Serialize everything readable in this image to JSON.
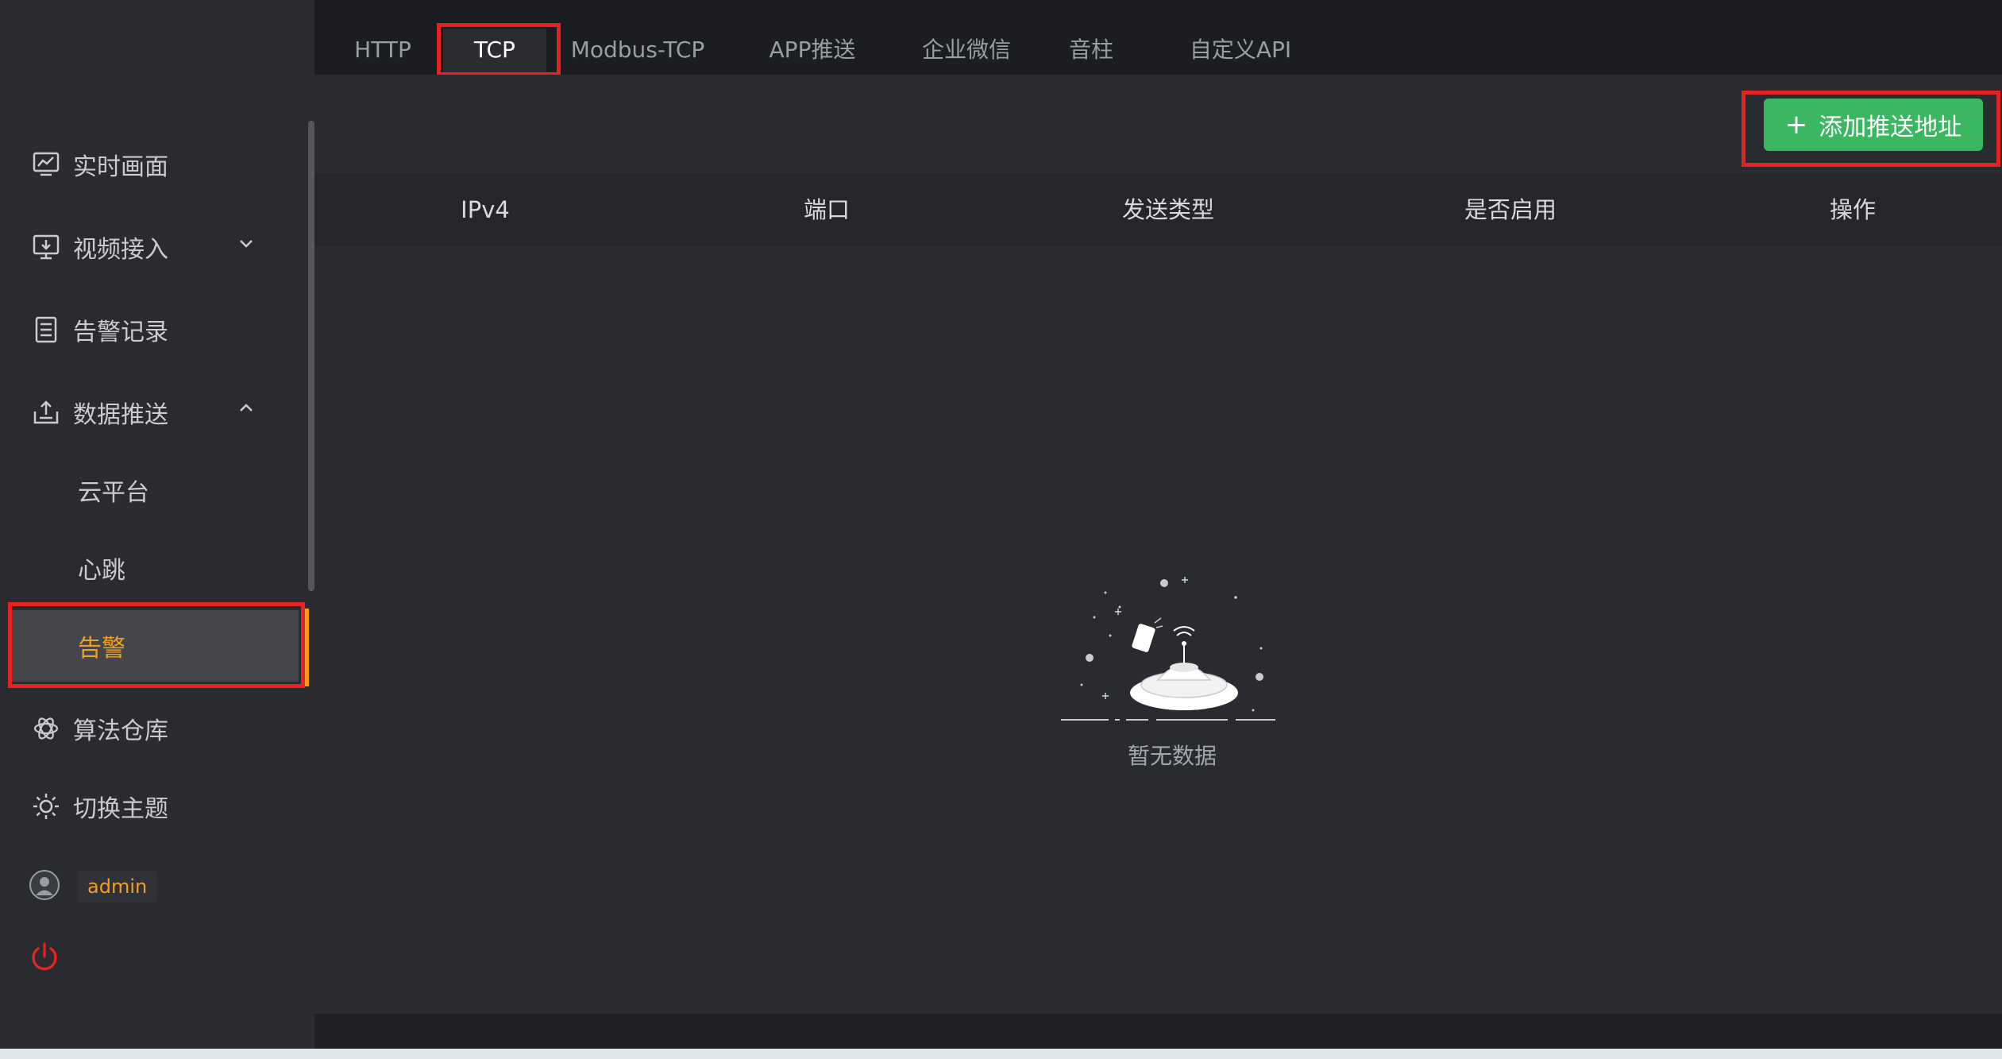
{
  "sidebar": {
    "items": [
      {
        "label": "实时画面",
        "icon": "monitor-chart-icon"
      },
      {
        "label": "视频接入",
        "icon": "video-input-icon",
        "expandable": true,
        "expanded": false
      },
      {
        "label": "告警记录",
        "icon": "list-doc-icon"
      },
      {
        "label": "数据推送",
        "icon": "upload-tray-icon",
        "expandable": true,
        "expanded": true
      }
    ],
    "sub_items": [
      "云平台",
      "心跳",
      "告警"
    ],
    "active_sub": "告警",
    "bottom_items": [
      {
        "label": "算法仓库",
        "icon": "atom-icon"
      },
      {
        "label": "切换主题",
        "icon": "sun-icon"
      }
    ],
    "user": {
      "name": "admin"
    }
  },
  "tabs": [
    "HTTP",
    "TCP",
    "Modbus-TCP",
    "APP推送",
    "企业微信",
    "音柱",
    "自定义API"
  ],
  "active_tab": "TCP",
  "toolbar": {
    "add_label": "添加推送地址",
    "add_icon": "plus-icon"
  },
  "table": {
    "columns": [
      "IPv4",
      "端口",
      "发送类型",
      "是否启用",
      "操作"
    ],
    "rows": [],
    "empty_text": "暂无数据"
  },
  "colors": {
    "accent": "#f0a020",
    "primary_button": "#3bb661",
    "highlight_box": "#e8221f",
    "power": "#e8221f"
  }
}
